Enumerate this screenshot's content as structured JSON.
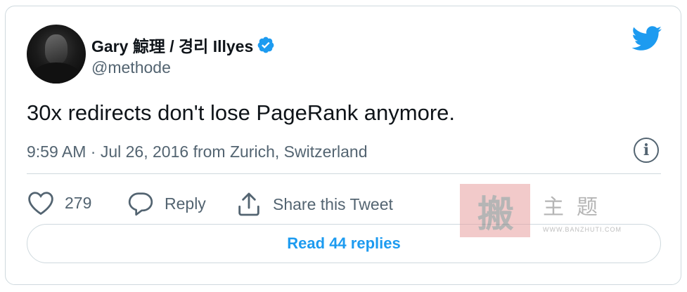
{
  "author": {
    "name": "Gary 鯨理 / 경리 Illyes",
    "handle": "@methode",
    "verified": true
  },
  "tweet": {
    "text": "30x redirects don't lose PageRank anymore.",
    "time": "9:59 AM",
    "separator": "·",
    "date": "Jul 26, 2016",
    "location": "from Zurich, Switzerland"
  },
  "actions": {
    "like_count": "279",
    "reply_label": "Reply",
    "share_label": "Share this Tweet"
  },
  "read_replies_label": "Read 44 replies",
  "watermark": {
    "seal": "搬",
    "chars": "主题",
    "url": "WWW.BANZHUTI.COM"
  },
  "colors": {
    "accent": "#1d9bf0",
    "text": "#0f1419",
    "secondary": "#536471",
    "border": "#cfd9de"
  },
  "icons": [
    "twitter-bird-icon",
    "verified-badge-icon",
    "info-icon",
    "heart-icon",
    "reply-bubble-icon",
    "share-icon"
  ]
}
